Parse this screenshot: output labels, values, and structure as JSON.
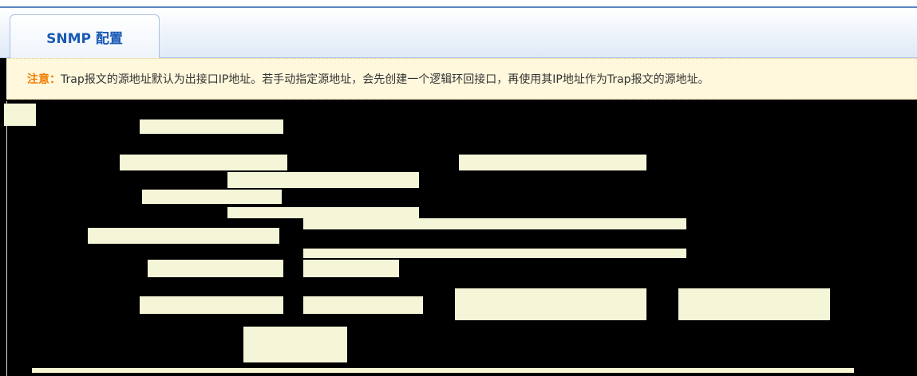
{
  "tab": {
    "label": "SNMP 配置"
  },
  "notice": {
    "label": "注意",
    "text": "Trap报文的源地址默认为出接口IP地址。若手动指定源地址，会先创建一个逻辑环回接口，再使用其IP地址作为Trap报文的源地址。"
  },
  "colors": {
    "accent": "#1a5ab5",
    "notice_bg": "#fff8dc",
    "notice_label": "#f07c00"
  }
}
